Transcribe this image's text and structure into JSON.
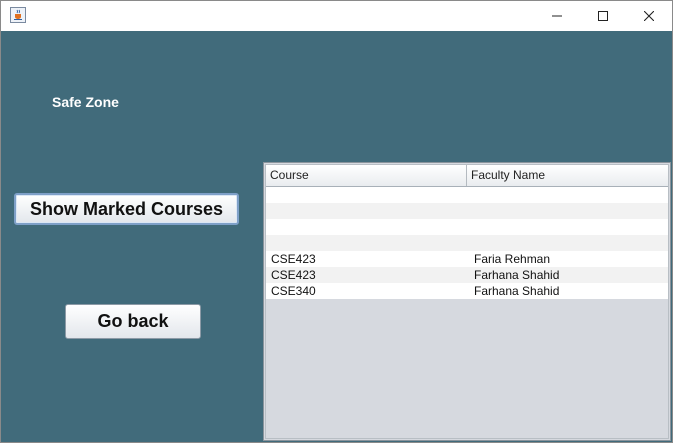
{
  "window": {
    "title": "",
    "icon": "java-cup-icon",
    "controls": [
      "minimize-icon",
      "maximize-icon",
      "close-icon"
    ]
  },
  "main": {
    "label": "Safe Zone",
    "show_button": "Show Marked Courses",
    "back_button": "Go back"
  },
  "table": {
    "headers": [
      "Course",
      "Faculty Name"
    ],
    "rows": [
      [
        "",
        ""
      ],
      [
        "",
        ""
      ],
      [
        "",
        ""
      ],
      [
        "",
        ""
      ],
      [
        "CSE423",
        "Faria Rehman"
      ],
      [
        "CSE423",
        "Farhana Shahid"
      ],
      [
        "CSE340",
        "Farhana Shahid"
      ]
    ]
  },
  "colors": {
    "background": "#416b7b",
    "table_empty_area": "#d6d9df",
    "row_alt": "#f2f2f2"
  }
}
